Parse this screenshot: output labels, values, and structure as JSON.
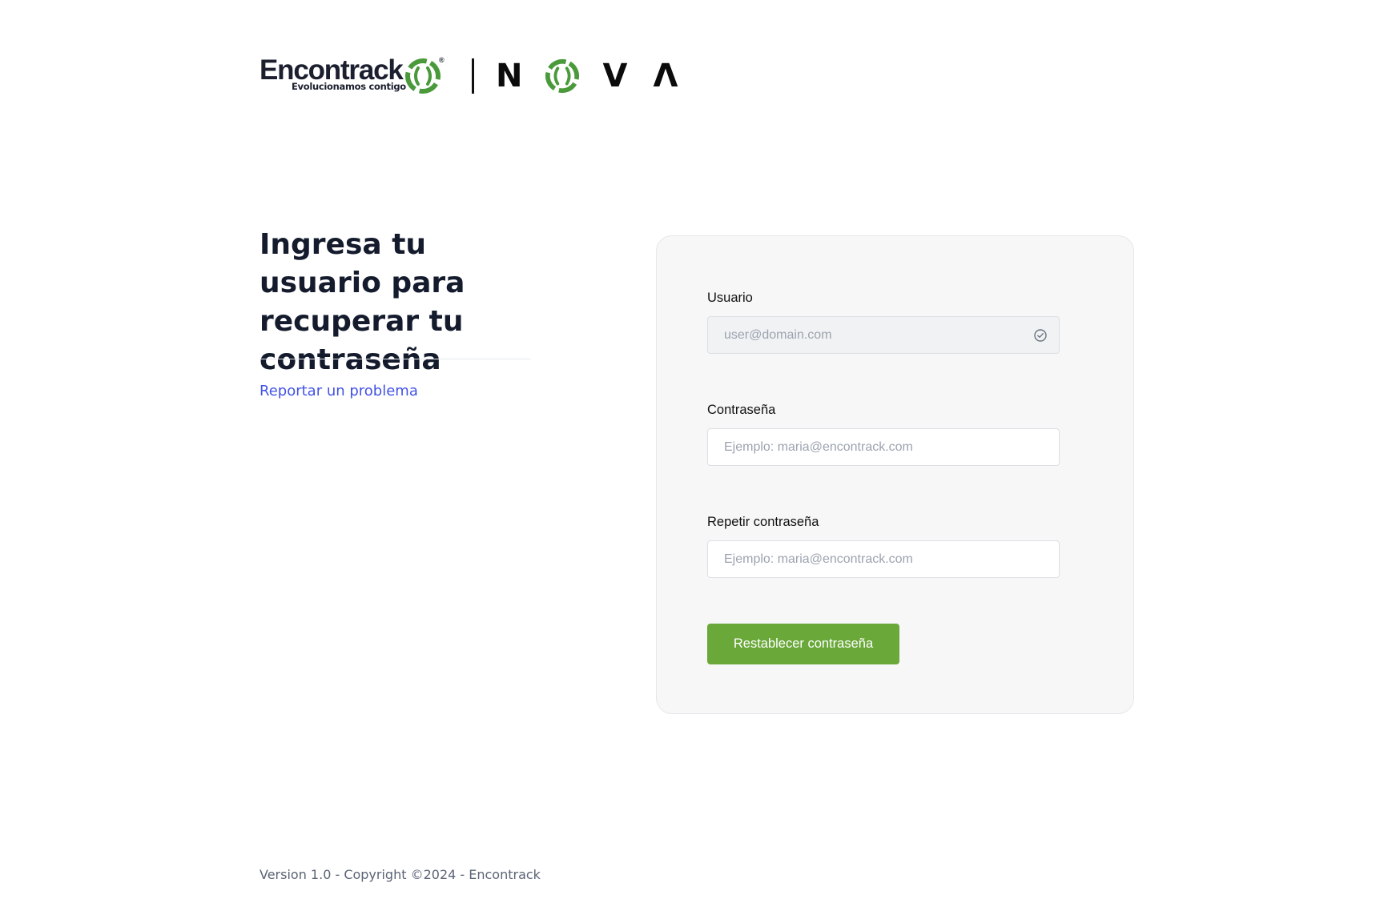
{
  "header": {
    "brand_name": "Encontrack",
    "brand_tagline": "Evolucionamos contigo",
    "brand_registered": "®",
    "product_letters": [
      "N",
      "V",
      "Λ"
    ],
    "brand_color": "#4a9a3c"
  },
  "left": {
    "heading": "Ingresa tu usuario para recuperar tu contraseña",
    "report_link": "Reportar un problema"
  },
  "form": {
    "user": {
      "label": "Usuario",
      "placeholder": "user@domain.com",
      "icon": "check-circle-icon"
    },
    "password": {
      "label": "Contraseña",
      "placeholder": "Ejemplo: maria@encontrack.com"
    },
    "repeat_password": {
      "label": "Repetir contraseña",
      "placeholder": "Ejemplo: maria@encontrack.com"
    },
    "submit_label": "Restablecer contraseña",
    "submit_color": "#6aa83a"
  },
  "footer": {
    "text": "Version 1.0 - Copyright ©2024 - Encontrack"
  }
}
